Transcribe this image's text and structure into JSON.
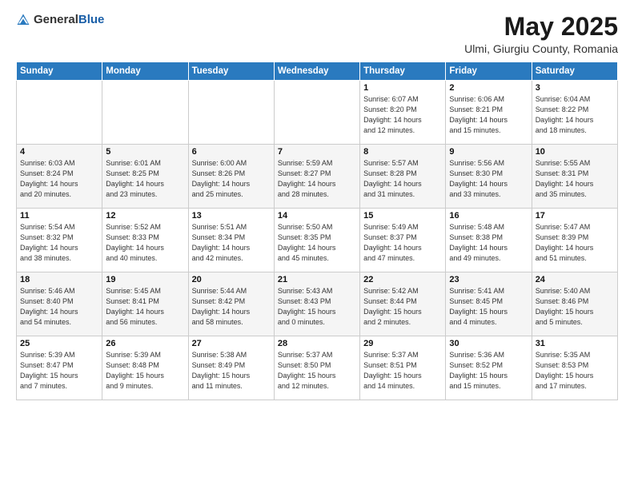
{
  "header": {
    "logo_general": "General",
    "logo_blue": "Blue",
    "title": "May 2025",
    "location": "Ulmi, Giurgiu County, Romania"
  },
  "days_of_week": [
    "Sunday",
    "Monday",
    "Tuesday",
    "Wednesday",
    "Thursday",
    "Friday",
    "Saturday"
  ],
  "weeks": [
    [
      {
        "day": "",
        "info": ""
      },
      {
        "day": "",
        "info": ""
      },
      {
        "day": "",
        "info": ""
      },
      {
        "day": "",
        "info": ""
      },
      {
        "day": "1",
        "info": "Sunrise: 6:07 AM\nSunset: 8:20 PM\nDaylight: 14 hours\nand 12 minutes."
      },
      {
        "day": "2",
        "info": "Sunrise: 6:06 AM\nSunset: 8:21 PM\nDaylight: 14 hours\nand 15 minutes."
      },
      {
        "day": "3",
        "info": "Sunrise: 6:04 AM\nSunset: 8:22 PM\nDaylight: 14 hours\nand 18 minutes."
      }
    ],
    [
      {
        "day": "4",
        "info": "Sunrise: 6:03 AM\nSunset: 8:24 PM\nDaylight: 14 hours\nand 20 minutes."
      },
      {
        "day": "5",
        "info": "Sunrise: 6:01 AM\nSunset: 8:25 PM\nDaylight: 14 hours\nand 23 minutes."
      },
      {
        "day": "6",
        "info": "Sunrise: 6:00 AM\nSunset: 8:26 PM\nDaylight: 14 hours\nand 25 minutes."
      },
      {
        "day": "7",
        "info": "Sunrise: 5:59 AM\nSunset: 8:27 PM\nDaylight: 14 hours\nand 28 minutes."
      },
      {
        "day": "8",
        "info": "Sunrise: 5:57 AM\nSunset: 8:28 PM\nDaylight: 14 hours\nand 31 minutes."
      },
      {
        "day": "9",
        "info": "Sunrise: 5:56 AM\nSunset: 8:30 PM\nDaylight: 14 hours\nand 33 minutes."
      },
      {
        "day": "10",
        "info": "Sunrise: 5:55 AM\nSunset: 8:31 PM\nDaylight: 14 hours\nand 35 minutes."
      }
    ],
    [
      {
        "day": "11",
        "info": "Sunrise: 5:54 AM\nSunset: 8:32 PM\nDaylight: 14 hours\nand 38 minutes."
      },
      {
        "day": "12",
        "info": "Sunrise: 5:52 AM\nSunset: 8:33 PM\nDaylight: 14 hours\nand 40 minutes."
      },
      {
        "day": "13",
        "info": "Sunrise: 5:51 AM\nSunset: 8:34 PM\nDaylight: 14 hours\nand 42 minutes."
      },
      {
        "day": "14",
        "info": "Sunrise: 5:50 AM\nSunset: 8:35 PM\nDaylight: 14 hours\nand 45 minutes."
      },
      {
        "day": "15",
        "info": "Sunrise: 5:49 AM\nSunset: 8:37 PM\nDaylight: 14 hours\nand 47 minutes."
      },
      {
        "day": "16",
        "info": "Sunrise: 5:48 AM\nSunset: 8:38 PM\nDaylight: 14 hours\nand 49 minutes."
      },
      {
        "day": "17",
        "info": "Sunrise: 5:47 AM\nSunset: 8:39 PM\nDaylight: 14 hours\nand 51 minutes."
      }
    ],
    [
      {
        "day": "18",
        "info": "Sunrise: 5:46 AM\nSunset: 8:40 PM\nDaylight: 14 hours\nand 54 minutes."
      },
      {
        "day": "19",
        "info": "Sunrise: 5:45 AM\nSunset: 8:41 PM\nDaylight: 14 hours\nand 56 minutes."
      },
      {
        "day": "20",
        "info": "Sunrise: 5:44 AM\nSunset: 8:42 PM\nDaylight: 14 hours\nand 58 minutes."
      },
      {
        "day": "21",
        "info": "Sunrise: 5:43 AM\nSunset: 8:43 PM\nDaylight: 15 hours\nand 0 minutes."
      },
      {
        "day": "22",
        "info": "Sunrise: 5:42 AM\nSunset: 8:44 PM\nDaylight: 15 hours\nand 2 minutes."
      },
      {
        "day": "23",
        "info": "Sunrise: 5:41 AM\nSunset: 8:45 PM\nDaylight: 15 hours\nand 4 minutes."
      },
      {
        "day": "24",
        "info": "Sunrise: 5:40 AM\nSunset: 8:46 PM\nDaylight: 15 hours\nand 5 minutes."
      }
    ],
    [
      {
        "day": "25",
        "info": "Sunrise: 5:39 AM\nSunset: 8:47 PM\nDaylight: 15 hours\nand 7 minutes."
      },
      {
        "day": "26",
        "info": "Sunrise: 5:39 AM\nSunset: 8:48 PM\nDaylight: 15 hours\nand 9 minutes."
      },
      {
        "day": "27",
        "info": "Sunrise: 5:38 AM\nSunset: 8:49 PM\nDaylight: 15 hours\nand 11 minutes."
      },
      {
        "day": "28",
        "info": "Sunrise: 5:37 AM\nSunset: 8:50 PM\nDaylight: 15 hours\nand 12 minutes."
      },
      {
        "day": "29",
        "info": "Sunrise: 5:37 AM\nSunset: 8:51 PM\nDaylight: 15 hours\nand 14 minutes."
      },
      {
        "day": "30",
        "info": "Sunrise: 5:36 AM\nSunset: 8:52 PM\nDaylight: 15 hours\nand 15 minutes."
      },
      {
        "day": "31",
        "info": "Sunrise: 5:35 AM\nSunset: 8:53 PM\nDaylight: 15 hours\nand 17 minutes."
      }
    ]
  ]
}
